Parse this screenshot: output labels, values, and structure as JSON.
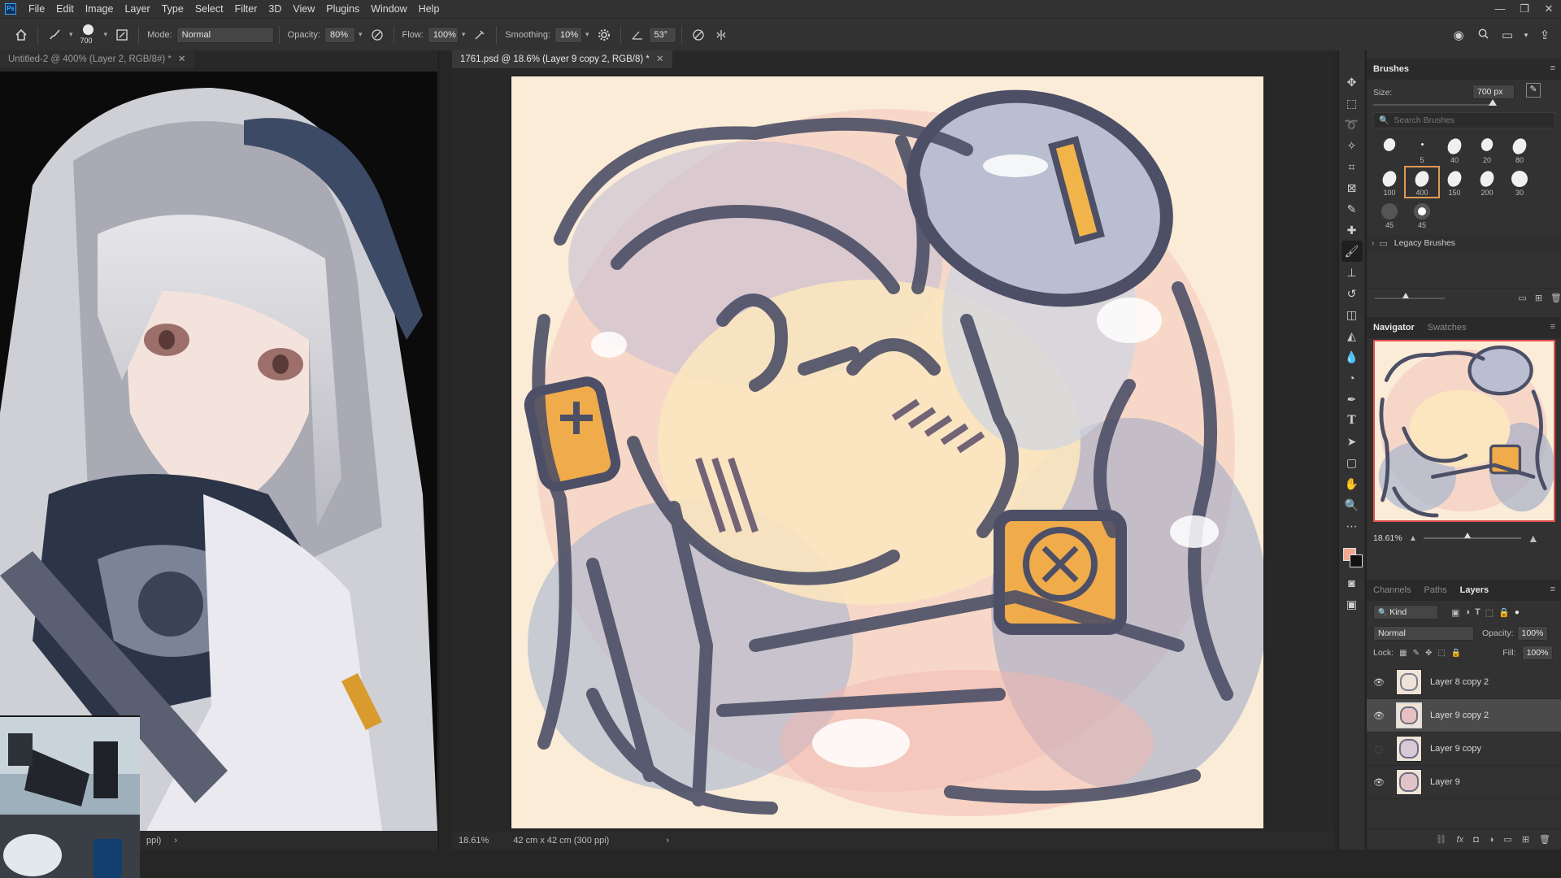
{
  "app": {
    "logo": "Ps"
  },
  "menu": [
    "File",
    "Edit",
    "Image",
    "Layer",
    "Type",
    "Select",
    "Filter",
    "3D",
    "View",
    "Plugins",
    "Window",
    "Help"
  ],
  "window_controls": [
    "—",
    "❐",
    "✕"
  ],
  "options": {
    "brush_size": "700",
    "mode_label": "Mode:",
    "mode_value": "Normal",
    "opacity_label": "Opacity:",
    "opacity_value": "80%",
    "flow_label": "Flow:",
    "flow_value": "100%",
    "smoothing_label": "Smoothing:",
    "smoothing_value": "10%",
    "angle_value": "53°"
  },
  "documents": {
    "left_tab": "Untitled-2 @ 400% (Layer 2, RGB/8#) *",
    "left_status": "ppi)",
    "right_tab": "1761.psd @ 18.6% (Layer 9 copy 2, RGB/8) *",
    "right_zoom": "18.61%",
    "right_dims": "42 cm x 42 cm (300 ppi)"
  },
  "brushes_panel": {
    "title": "Brushes",
    "size_label": "Size:",
    "size_value": "700 px",
    "search_placeholder": "Search Brushes",
    "presets": [
      "",
      "5",
      "40",
      "20",
      "80",
      "100",
      "400",
      "150",
      "200",
      "30",
      "45",
      "45"
    ],
    "selected_index": 6,
    "folder_label": "Legacy Brushes"
  },
  "navigator_panel": {
    "tabs": [
      "Navigator",
      "Swatches"
    ],
    "zoom": "18.61%"
  },
  "layers_panel": {
    "tabs": [
      "Channels",
      "Paths",
      "Layers"
    ],
    "filter_kind": "Kind",
    "blend_mode": "Normal",
    "opacity_label": "Opacity:",
    "opacity_value": "100%",
    "lock_label": "Lock:",
    "fill_label": "Fill:",
    "fill_value": "100%",
    "layers": [
      {
        "name": "Layer 8 copy 2",
        "visible": true,
        "selected": false
      },
      {
        "name": "Layer 9 copy 2",
        "visible": true,
        "selected": true
      },
      {
        "name": "Layer 9 copy",
        "visible": false,
        "selected": false
      },
      {
        "name": "Layer 9",
        "visible": true,
        "selected": false
      }
    ]
  },
  "colors": {
    "foreground": "#f2a795",
    "background": "#111111",
    "canvas": "#fbecd7",
    "accent": "#e09a55"
  }
}
